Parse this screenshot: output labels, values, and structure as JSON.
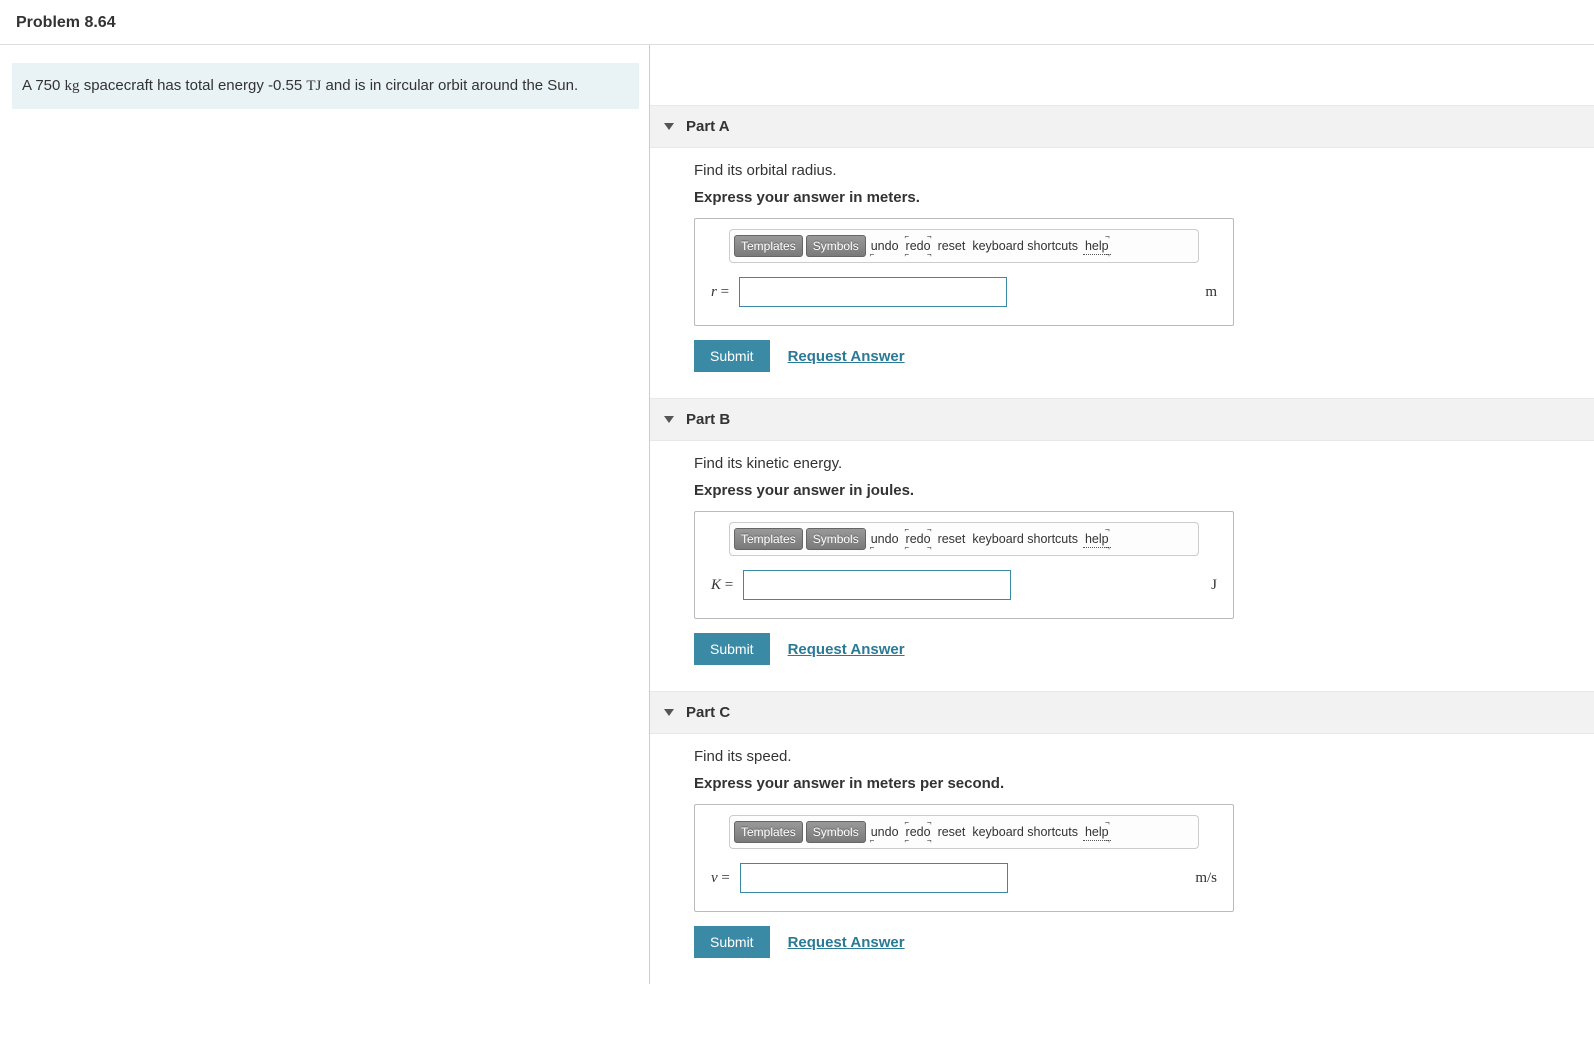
{
  "header": {
    "title": "Problem 8.64"
  },
  "problem": {
    "prefix": "A 750 ",
    "unit1": "kg",
    "mid": " spacecraft has total energy -0.55 ",
    "unit2": "TJ",
    "suffix": " and is in circular orbit around the Sun."
  },
  "toolbar": {
    "templates": "Templates",
    "symbols": "Symbols",
    "undo": "undo",
    "redo": "redo",
    "reset": "reset",
    "keyboard": "keyboard shortcuts",
    "help": "help"
  },
  "actions": {
    "submit": "Submit",
    "request": "Request Answer"
  },
  "parts": [
    {
      "id": "A",
      "title": "Part A",
      "prompt": "Find its orbital radius.",
      "instruction": "Express your answer in meters.",
      "var": "r",
      "unit": "m",
      "value": ""
    },
    {
      "id": "B",
      "title": "Part B",
      "prompt": "Find its kinetic energy.",
      "instruction": "Express your answer in joules.",
      "var": "K",
      "unit": "J",
      "value": ""
    },
    {
      "id": "C",
      "title": "Part C",
      "prompt": "Find its speed.",
      "instruction": "Express your answer in meters per second.",
      "var": "v",
      "unit": "m/s",
      "value": ""
    }
  ]
}
